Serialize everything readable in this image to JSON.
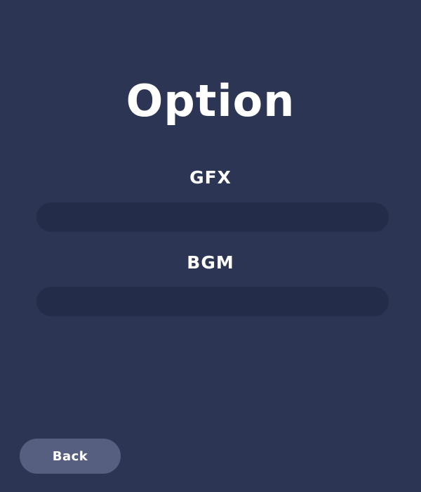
{
  "title": "Option",
  "settings": [
    {
      "id": "gfx",
      "label": "GFX",
      "level": 0
    },
    {
      "id": "bgm",
      "label": "BGM",
      "level": 0
    }
  ],
  "back_button": {
    "label": "Back"
  },
  "colors": {
    "background": "#2c3654",
    "slider_track": "#232c48",
    "button": "#575f80",
    "text": "#ffffff"
  }
}
